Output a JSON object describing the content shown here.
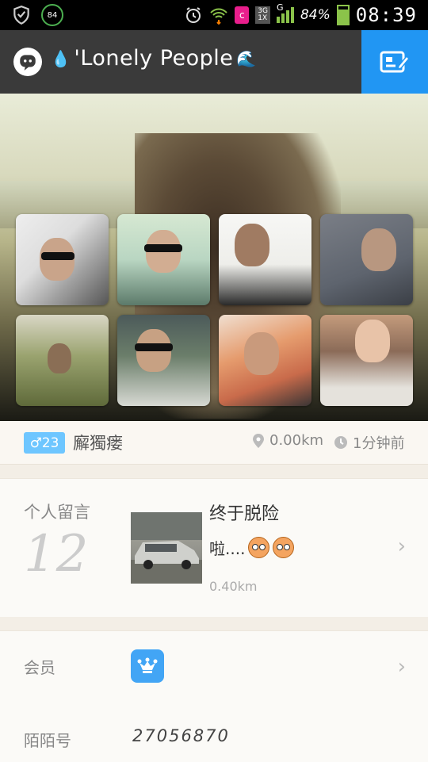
{
  "status_bar": {
    "battery_circle": "84",
    "network_badge_top": "3G",
    "network_badge_bottom": "1X",
    "signal_label": "G",
    "battery_percent": "84%",
    "battery_level": 0.84,
    "time": "08:39"
  },
  "app_bar": {
    "title": "'Lonely People",
    "accent": "#2196f3"
  },
  "profile": {
    "gender_age": "♂23",
    "name": "廨獨瘘",
    "distance": "0.00km",
    "time_ago": "1分钟前"
  },
  "message_section": {
    "label": "个人留言",
    "count": "12",
    "text_line1": "终于脱险",
    "text_line2": "啦....",
    "distance": "0.40km"
  },
  "member_section": {
    "label": "会员"
  },
  "momo_section": {
    "label": "陌陌号",
    "value": "27056870"
  },
  "colors": {
    "gender_badge": "#6ec6ff",
    "crown_badge": "#42a5f5",
    "app_bar_bg": "#3a3a3a"
  }
}
